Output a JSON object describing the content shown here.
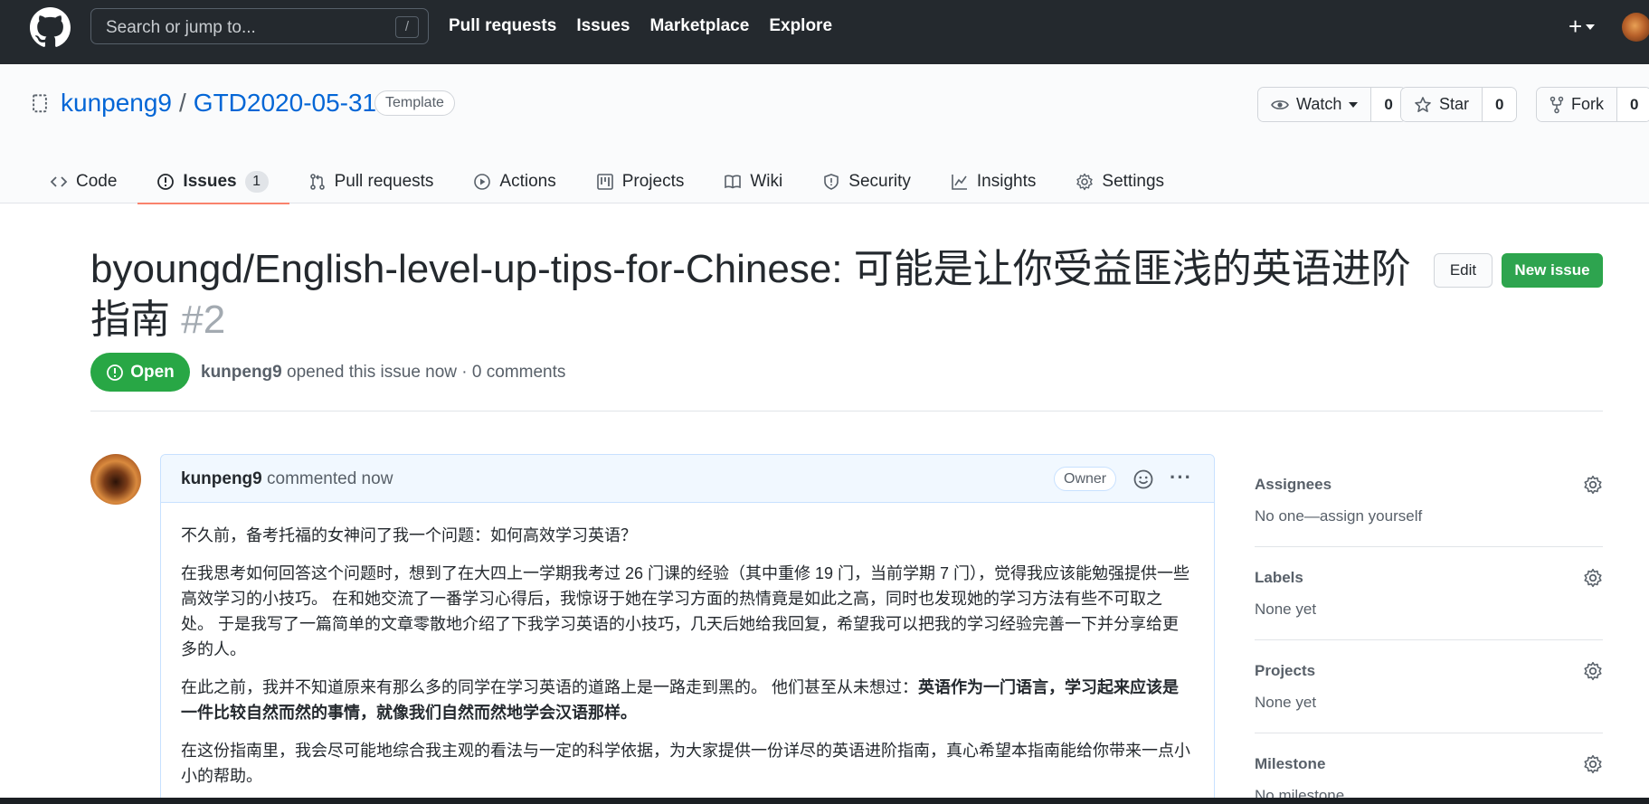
{
  "header": {
    "search_placeholder": "Search or jump to...",
    "search_shortcut": "/",
    "nav": [
      "Pull requests",
      "Issues",
      "Marketplace",
      "Explore"
    ],
    "plus_label": "+"
  },
  "repo": {
    "owner": "kunpeng9",
    "separator": "/",
    "name": "GTD2020-05-31",
    "template_badge": "Template",
    "watch_label": "Watch",
    "watch_count": "0",
    "star_label": "Star",
    "star_count": "0",
    "fork_label": "Fork",
    "fork_count": "0"
  },
  "tabs": {
    "code": "Code",
    "issues": "Issues",
    "issues_count": "1",
    "pull_requests": "Pull requests",
    "actions": "Actions",
    "projects": "Projects",
    "wiki": "Wiki",
    "security": "Security",
    "insights": "Insights",
    "settings": "Settings"
  },
  "issue": {
    "title": "byoungd/English-level-up-tips-for-Chinese: 可能是让你受益匪浅的英语进阶指南",
    "number": "#2",
    "edit_label": "Edit",
    "new_issue_label": "New issue",
    "state": "Open",
    "author": "kunpeng9",
    "meta_text": " opened this issue now · 0 comments"
  },
  "comment": {
    "author": "kunpeng9",
    "time_text": " commented now",
    "owner_badge": "Owner",
    "more_label": "···",
    "paragraphs": [
      "不久前，备考托福的女神问了我一个问题：如何高效学习英语？",
      "在我思考如何回答这个问题时，想到了在大四上一学期我考过 26 门课的经验（其中重修 19 门，当前学期 7 门），觉得我应该能勉强提供一些高效学习的小技巧。 在和她交流了一番学习心得后，我惊讶于她在学习方面的热情竟是如此之高，同时也发现她的学习方法有些不可取之处。 于是我写了一篇简单的文章零散地介绍了下我学习英语的小技巧，几天后她给我回复，希望我可以把我的学习经验完善一下并分享给更多的人。",
      "在此之前，我并不知道原来有那么多的同学在学习英语的道路上是一路走到黑的。 他们甚至从未想过：",
      "英语作为一门语言，学习起来应该是一件比较自然而然的事情，就像我们自然而然地学会汉语那样。",
      "在这份指南里，我会尽可能地综合我主观的看法与一定的科学依据，为大家提供一份详尽的英语进阶指南，真心希望本指南能给你带来一点小小的帮助。"
    ]
  },
  "sidebar": {
    "sections": [
      {
        "heading": "Assignees",
        "value": "No one—assign yourself"
      },
      {
        "heading": "Labels",
        "value": "None yet"
      },
      {
        "heading": "Projects",
        "value": "None yet"
      },
      {
        "heading": "Milestone",
        "value": "No milestone"
      }
    ]
  },
  "colors": {
    "header_bg": "#24292e",
    "link": "#0366d6",
    "open_green": "#28a745",
    "tab_underline": "#f9826c"
  }
}
